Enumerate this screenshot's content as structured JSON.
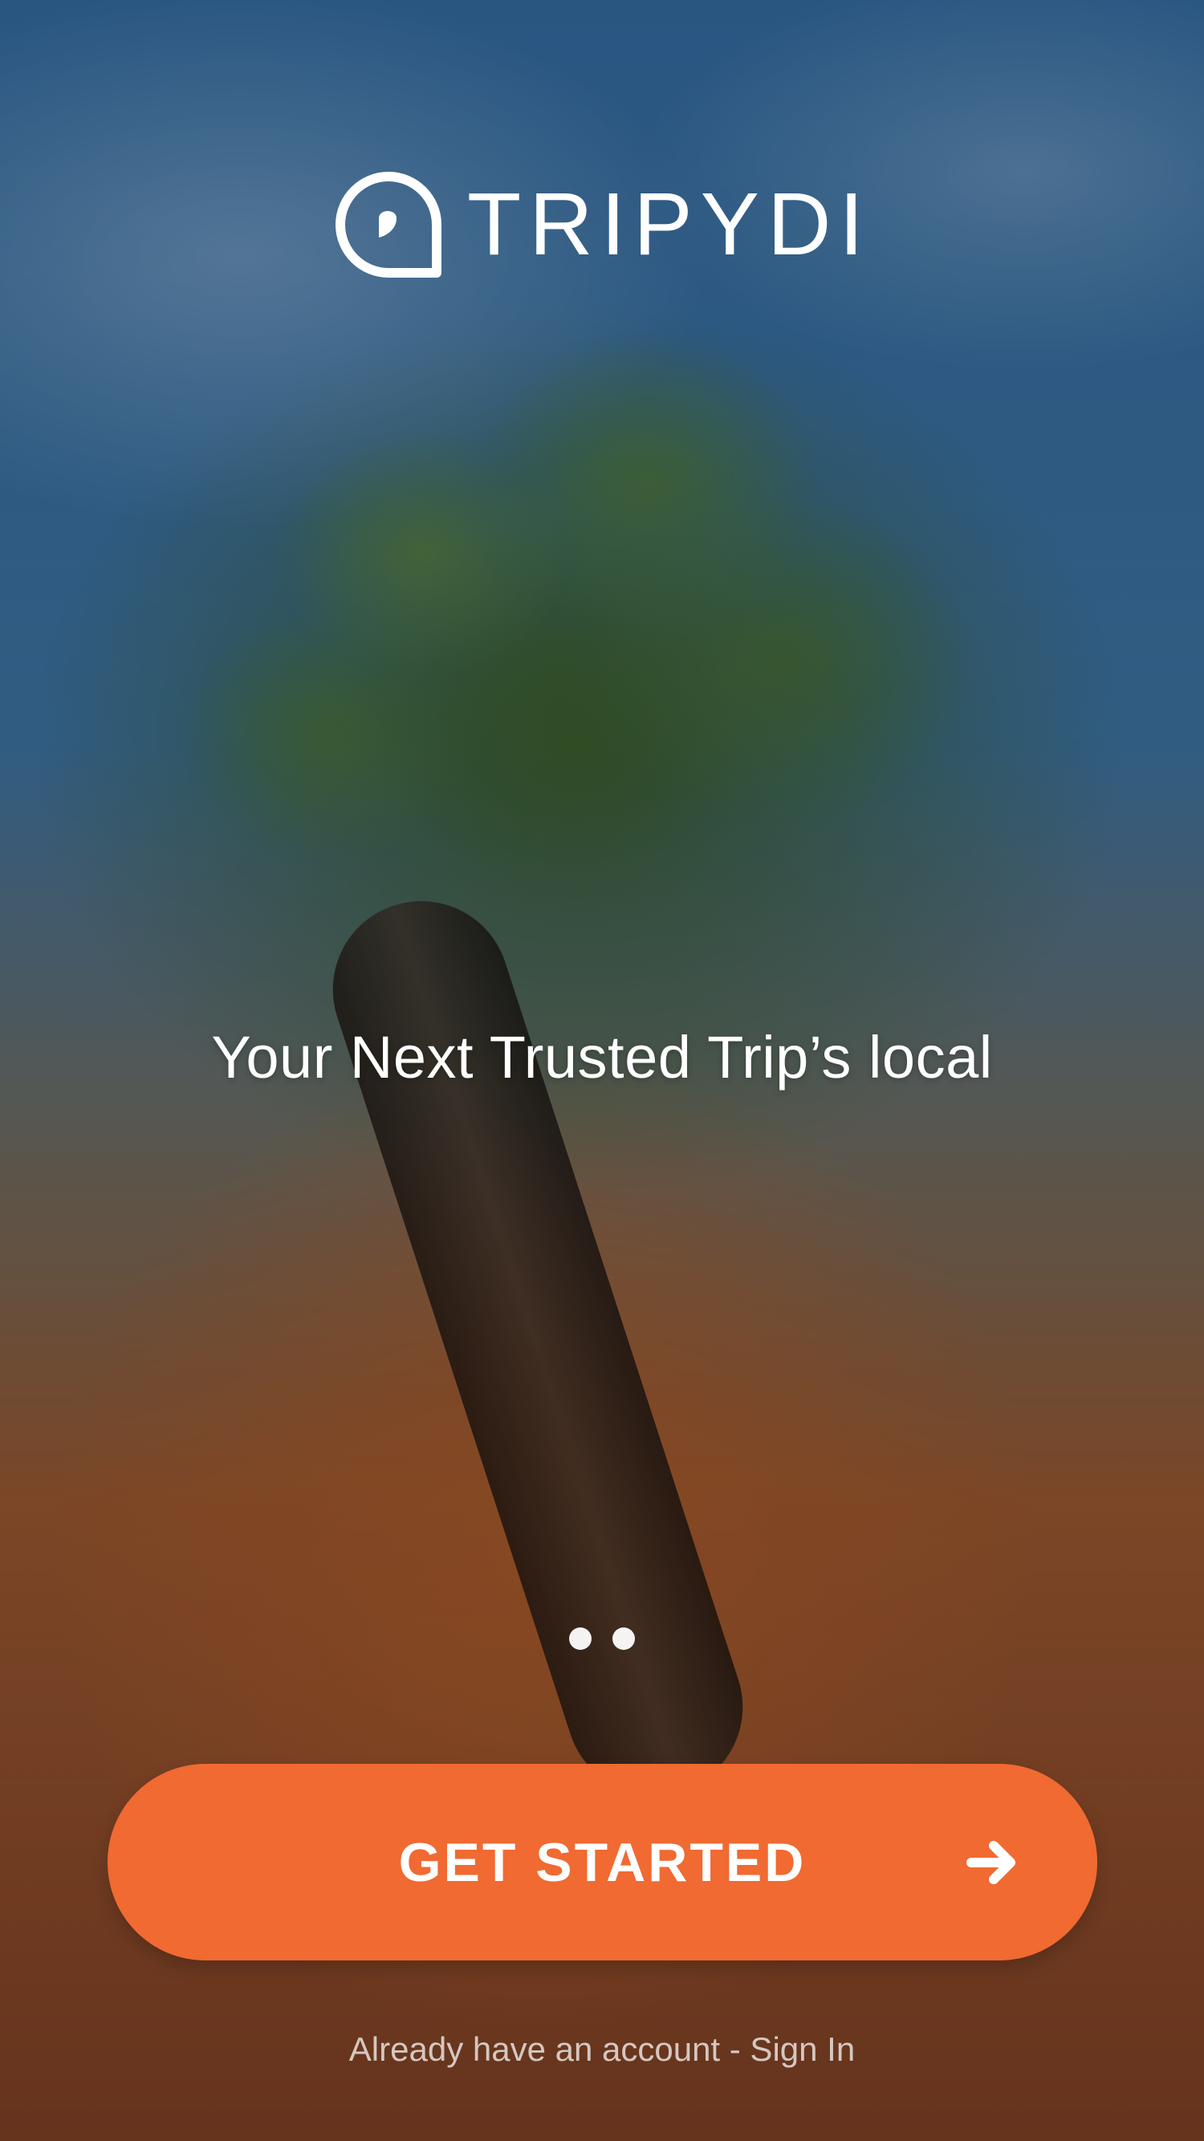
{
  "brand": {
    "name": "TRIPYDI",
    "logo_icon": "location-pin-icon"
  },
  "hero": {
    "tagline": "Your Next Trusted Trip’s local"
  },
  "pager": {
    "dots": 2
  },
  "cta": {
    "label": "GET STARTED",
    "arrow_icon": "arrow-right-icon",
    "color": "#f06a32"
  },
  "footer": {
    "signin_text": "Already have an account - Sign In"
  }
}
